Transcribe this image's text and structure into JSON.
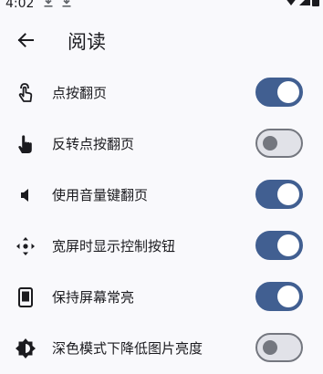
{
  "status_bar": {
    "time": "4:02",
    "icons": [
      "download-icon",
      "download-icon",
      "wifi-icon",
      "signal-icon",
      "battery-icon"
    ]
  },
  "app_bar": {
    "back_icon": "arrow-back-icon",
    "title": "阅读"
  },
  "settings": [
    {
      "icon": "touch-app-icon",
      "label": "点按翻页",
      "enabled": true
    },
    {
      "icon": "pointer-hand-icon",
      "label": "反转点按翻页",
      "enabled": false
    },
    {
      "icon": "volume-icon",
      "label": "使用音量键翻页",
      "enabled": true
    },
    {
      "icon": "control-move-icon",
      "label": "宽屏时显示控制按钮",
      "enabled": true
    },
    {
      "icon": "phone-screen-icon",
      "label": "保持屏幕常亮",
      "enabled": true
    },
    {
      "icon": "brightness-icon",
      "label": "深色模式下降低图片亮度",
      "enabled": false
    }
  ],
  "colors": {
    "switch_on_track": "#415f91",
    "switch_off_track": "#e1e2e8",
    "switch_off_outline": "#74777f",
    "background": "#f9f9fc"
  }
}
